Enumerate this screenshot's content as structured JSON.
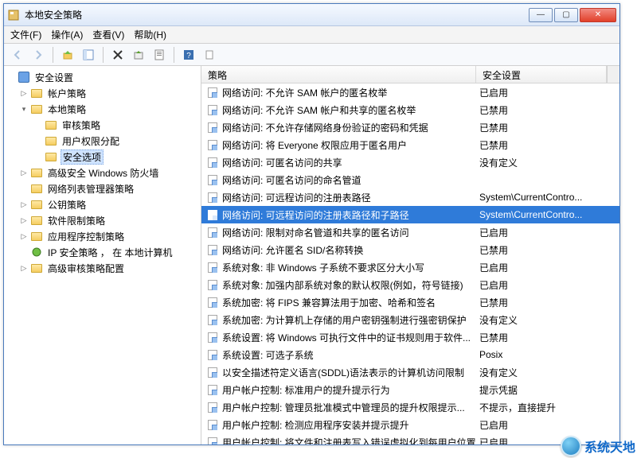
{
  "window": {
    "title": "本地安全策略"
  },
  "menu": {
    "file": "文件(F)",
    "action": "操作(A)",
    "view": "查看(V)",
    "help": "帮助(H)"
  },
  "columns": {
    "policy": "策略",
    "setting": "安全设置"
  },
  "tree": {
    "root": "安全设置",
    "n0": "帐户策略",
    "n1": "本地策略",
    "n1a": "审核策略",
    "n1b": "用户权限分配",
    "n1c": "安全选项",
    "n2": "高级安全 Windows 防火墙",
    "n3": "网络列表管理器策略",
    "n4": "公钥策略",
    "n5": "软件限制策略",
    "n6": "应用程序控制策略",
    "n7": "IP 安全策略 ， 在 本地计算机",
    "n8": "高级审核策略配置"
  },
  "rows": [
    {
      "p": "网络访问: 不允许 SAM 帐户的匿名枚举",
      "s": "已启用"
    },
    {
      "p": "网络访问: 不允许 SAM 帐户和共享的匿名枚举",
      "s": "已禁用"
    },
    {
      "p": "网络访问: 不允许存储网络身份验证的密码和凭据",
      "s": "已禁用"
    },
    {
      "p": "网络访问: 将 Everyone 权限应用于匿名用户",
      "s": "已禁用"
    },
    {
      "p": "网络访问: 可匿名访问的共享",
      "s": "没有定义"
    },
    {
      "p": "网络访问: 可匿名访问的命名管道",
      "s": ""
    },
    {
      "p": "网络访问: 可远程访问的注册表路径",
      "s": "System\\CurrentContro..."
    },
    {
      "p": "网络访问: 可远程访问的注册表路径和子路径",
      "s": "System\\CurrentContro...",
      "selected": true
    },
    {
      "p": "网络访问: 限制对命名管道和共享的匿名访问",
      "s": "已启用"
    },
    {
      "p": "网络访问: 允许匿名 SID/名称转换",
      "s": "已禁用"
    },
    {
      "p": "系统对象: 非 Windows 子系统不要求区分大小写",
      "s": "已启用"
    },
    {
      "p": "系统对象: 加强内部系统对象的默认权限(例如，符号链接)",
      "s": "已启用"
    },
    {
      "p": "系统加密: 将 FIPS 兼容算法用于加密、哈希和签名",
      "s": "已禁用"
    },
    {
      "p": "系统加密: 为计算机上存储的用户密钥强制进行强密钥保护",
      "s": "没有定义"
    },
    {
      "p": "系统设置: 将 Windows 可执行文件中的证书规则用于软件...",
      "s": "已禁用"
    },
    {
      "p": "系统设置: 可选子系统",
      "s": "Posix"
    },
    {
      "p": "以安全描述符定义语言(SDDL)语法表示的计算机访问限制",
      "s": "没有定义"
    },
    {
      "p": "用户帐户控制: 标准用户的提升提示行为",
      "s": "提示凭据"
    },
    {
      "p": "用户帐户控制: 管理员批准模式中管理员的提升权限提示...",
      "s": "不提示，直接提升"
    },
    {
      "p": "用户帐户控制: 检测应用程序安装并提示提升",
      "s": "已启用"
    },
    {
      "p": "用户帐户控制: 将文件和注册表写入错误虚拟化到每用户位置",
      "s": "已启用"
    }
  ],
  "watermark": {
    "text": "系统天地"
  }
}
